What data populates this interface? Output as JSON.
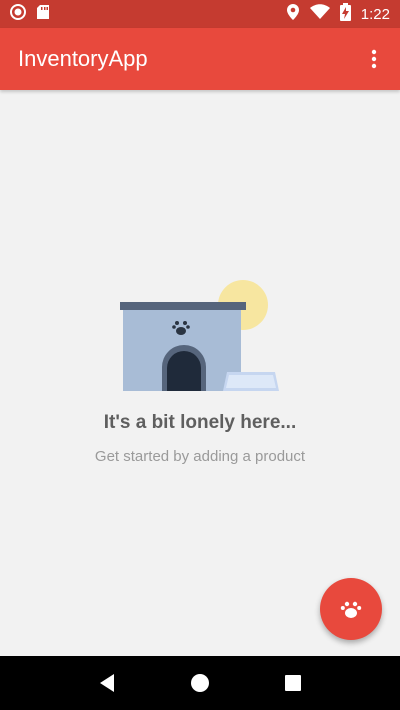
{
  "status_bar": {
    "time": "1:22",
    "left_icons": [
      "record-icon",
      "sd-card-icon"
    ],
    "right_icons": [
      "location-icon",
      "wifi-icon",
      "battery-charging-icon"
    ]
  },
  "app_bar": {
    "title": "InventoryApp",
    "overflow_icon": "more-vert-icon"
  },
  "empty_state": {
    "title": "It's a bit lonely here...",
    "subtitle": "Get started by adding a product"
  },
  "fab": {
    "icon": "paw-icon"
  },
  "nav_bar": {
    "icons": [
      "back-icon",
      "home-icon",
      "recents-icon"
    ]
  },
  "colors": {
    "primary": "#e8493d",
    "primary_dark": "#c53b30",
    "background": "#f2f2f2",
    "title_text": "#5f5f5f",
    "subtitle_text": "#9a9a9a"
  }
}
